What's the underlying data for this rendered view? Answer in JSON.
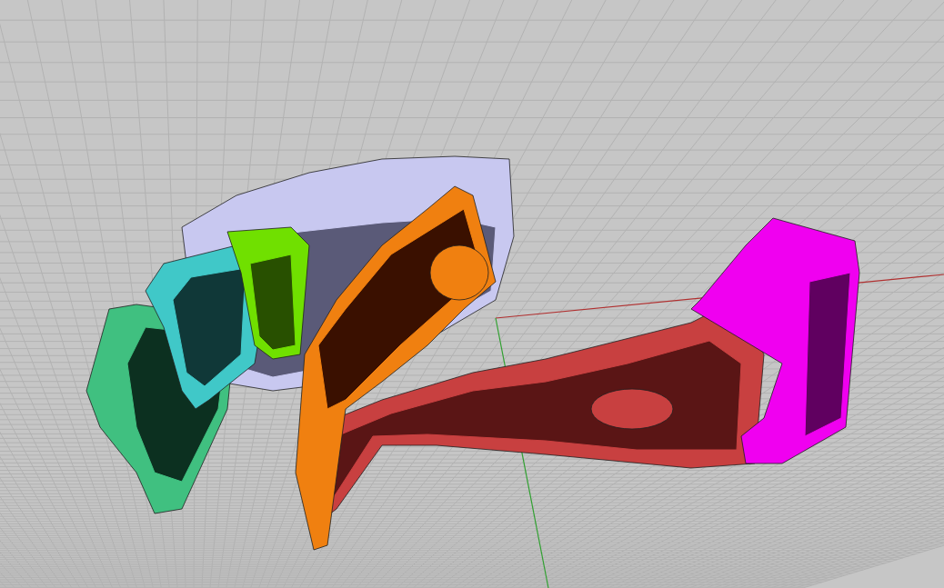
{
  "viewport": {
    "parts": [
      {
        "kind": "band",
        "color": "#c8c8f0"
      },
      {
        "kind": "outerlink",
        "color": "#40c080"
      },
      {
        "kind": "innerlink",
        "color": "#40c8c8"
      },
      {
        "kind": "centerlink",
        "color": "#70e000"
      },
      {
        "kind": "arm",
        "color": "#c84040"
      },
      {
        "kind": "clasp",
        "color": "#f08010"
      },
      {
        "kind": "buckle",
        "color": "#f000f0"
      }
    ]
  }
}
